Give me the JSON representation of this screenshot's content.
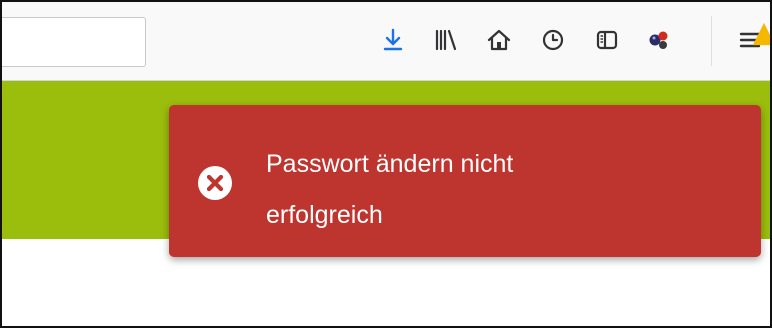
{
  "toolbar": {
    "icons": [
      {
        "name": "download-icon",
        "color": "#1a73e8"
      },
      {
        "name": "library-icon"
      },
      {
        "name": "home-icon"
      },
      {
        "name": "history-icon"
      },
      {
        "name": "sidebar-icon"
      },
      {
        "name": "extension-icon"
      },
      {
        "name": "menu-icon",
        "badge": "warning"
      }
    ]
  },
  "colors": {
    "header_band": "#9bbd0b",
    "toast_background": "#be342f",
    "toast_text": "#ffffff"
  },
  "toast": {
    "type": "error",
    "icon": "error-circle-icon",
    "message": "Passwort ändern nicht erfolgreich"
  }
}
